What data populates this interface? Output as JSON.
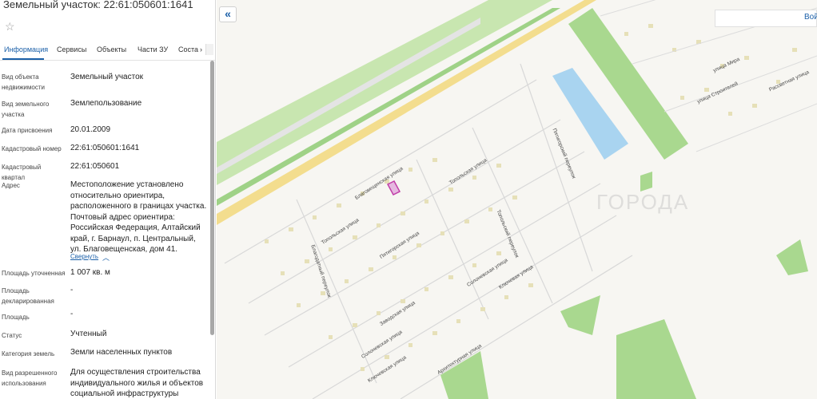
{
  "panel": {
    "title": "Земельный участок: 22:61:050601:1641",
    "tabs": [
      "Информация",
      "Сервисы",
      "Объекты",
      "Части ЗУ",
      "Соста"
    ],
    "rows": [
      {
        "label": "Вид объекта недвижимости",
        "value": "Земельный участок"
      },
      {
        "label": "Вид земельного участка",
        "value": "Землепользование"
      },
      {
        "label": "Дата присвоения",
        "value": "20.01.2009"
      },
      {
        "label": "Кадастровый номер",
        "value": "22:61:050601:1641"
      },
      {
        "label": "Кадастровый квартал",
        "value": "22:61:050601"
      },
      {
        "label": "Адрес",
        "value": "Местоположение установлено относительно ориентира, расположенного в границах участка. Почтовый адрес ориентира: Российская Федерация, Алтайский край, г. Барнаул, п. Центральный, ул. Благовещенская, дом 41."
      },
      {
        "label": "Площадь уточненная",
        "value": "1 007 кв. м"
      },
      {
        "label": "Площадь декларированная",
        "value": "-"
      },
      {
        "label": "Площадь",
        "value": "-"
      },
      {
        "label": "Статус",
        "value": "Учтенный"
      },
      {
        "label": "Категория земель",
        "value": "Земли населенных пунктов"
      },
      {
        "label": "Вид разрешенного использования",
        "value": "Для осуществления строительства индивидуального жилья и объектов социальной инфраструктуры"
      }
    ],
    "collapse_link": "Свернуть"
  },
  "map": {
    "login_label": "Вой",
    "watermark": "ГОРОДА",
    "streets": [
      "Благовещенская улица",
      "Топольская улица",
      "Топольская улица",
      "Пятигорская улица",
      "Пятигорская улица",
      "Пятигорский переулок",
      "Благодатный переулок",
      "Топольский переулок",
      "Заводская улица",
      "Солоневская улица",
      "Ключевая улица",
      "Солоневская улица",
      "Ключевская улица",
      "Архитектурная улица",
      "улица Мира",
      "улица Строителей",
      "Рассветная улица"
    ]
  },
  "colors": {
    "accent": "#1a5fa8",
    "map_bg": "#f7f6f2",
    "green_area": "#a9d88f",
    "water": "#a9d4f0",
    "road_main": "#f3dd8e",
    "parcel": "#c13ea8"
  },
  "icons": [
    "star-icon",
    "chevron-up-icon",
    "chevron-left-double-icon"
  ]
}
